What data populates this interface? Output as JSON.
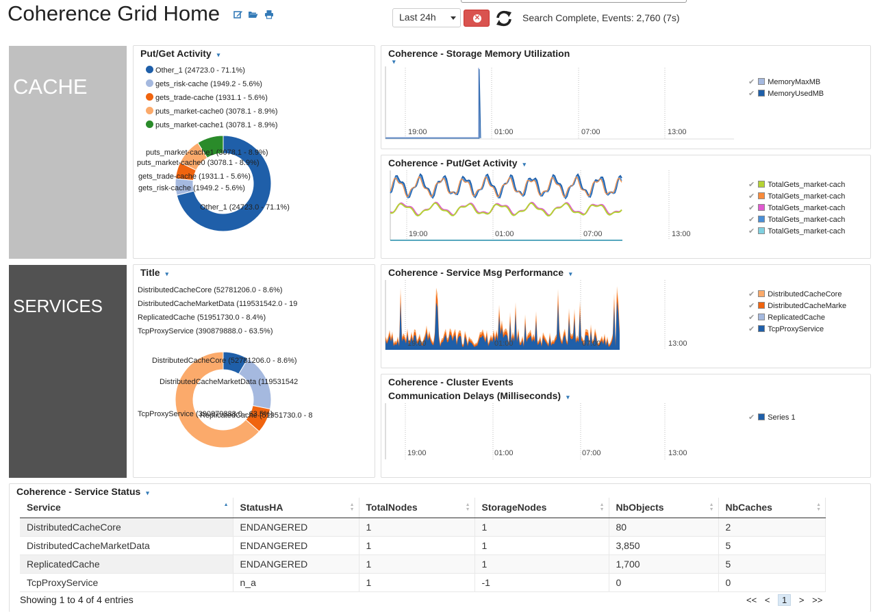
{
  "header": {
    "title": "Coherence Grid Home",
    "icons": [
      "edit-icon",
      "folder-open-icon",
      "print-icon"
    ],
    "time_range": "Last 24h",
    "status": "Search Complete, Events: 2,760 (7s)"
  },
  "sections": {
    "cache_label": "CACHE",
    "services_label": "SERVICES"
  },
  "colors": {
    "cache_tile": "#c0c0c0",
    "services_tile": "#525252",
    "accent_blue": "#1f5fa9",
    "orange": "#f59a4a"
  },
  "putget_pie": {
    "title": "Put/Get Activity",
    "legend": [
      {
        "label": "Other_1 (24723.0 - 71.1%)",
        "color": "#1f5fa9",
        "percent": 71.1
      },
      {
        "label": "gets_risk-cache (1949.2 - 5.6%)",
        "color": "#a5b9df",
        "percent": 5.6
      },
      {
        "label": "gets_trade-cache (1931.1 - 5.6%)",
        "color": "#f0640f",
        "percent": 5.6
      },
      {
        "label": "puts_market-cache0 (3078.1 - 8.9%)",
        "color": "#fbaa6b",
        "percent": 8.9
      },
      {
        "label": "puts_market-cache1 (3078.1 - 8.9%)",
        "color": "#2a8b2a",
        "percent": 8.9
      }
    ],
    "donut_labels": [
      "puts_market-cache1 (3078.1 - 8.9%)",
      "puts_market-cache0 (3078.1 - 8.9%)",
      "gets_trade-cache (1931.1 - 5.6%)",
      "gets_risk-cache (1949.2 - 5.6%)",
      "Other_1 (24723.0 - 71.1%)"
    ]
  },
  "services_pie": {
    "title": "Title",
    "legend": [
      "DistributedCacheCore (52781206.0 - 8.6%)",
      "DistributedCacheMarketData (119531542.0 - 19",
      "ReplicatedCache (51951730.0 - 8.4%)",
      "TcpProxyService (390879888.0 - 63.5%)"
    ],
    "donut_labels": [
      "DistributedCacheCore (52781206.0 - 8.6%)",
      "DistributedCacheMarketData (119531542",
      "ReplicatedCache (51951730.0 - 8",
      "TcpProxyService (390879888.0 - 63.5%)"
    ],
    "slices": [
      {
        "name": "DistributedCacheCore",
        "percent": 8.6,
        "color": "#1f5fa9"
      },
      {
        "name": "DistributedCacheMarketData",
        "percent": 19.5,
        "color": "#a5b9df"
      },
      {
        "name": "ReplicatedCache",
        "percent": 8.4,
        "color": "#f0640f"
      },
      {
        "name": "TcpProxyService",
        "percent": 63.5,
        "color": "#fbaa6b"
      }
    ]
  },
  "memory_chart": {
    "title": "Coherence - Storage Memory Utilization",
    "ticks": [
      "19:00",
      "01:00",
      "07:00",
      "13:00"
    ],
    "legend": [
      {
        "label": "MemoryMaxMB",
        "color": "#a5b9df"
      },
      {
        "label": "MemoryUsedMB",
        "color": "#1f5fa9"
      }
    ]
  },
  "putget_chart": {
    "title": "Coherence - Put/Get Activity",
    "ticks": [
      "19:00",
      "01:00",
      "07:00",
      "13:00"
    ],
    "legend": [
      {
        "label": "TotalGets_market-cach",
        "color": "#b5d334"
      },
      {
        "label": "TotalGets_market-cach",
        "color": "#f98b3b"
      },
      {
        "label": "TotalGets_market-cach",
        "color": "#e05ad0"
      },
      {
        "label": "TotalGets_market-cach",
        "color": "#4a8fd8"
      },
      {
        "label": "TotalGets_market-cach",
        "color": "#7fd0e0"
      }
    ]
  },
  "msg_chart": {
    "title": "Coherence - Service Msg Performance",
    "ticks": [
      "19:00",
      "01:00",
      "07:00",
      "13:00"
    ],
    "legend": [
      {
        "label": "DistributedCacheCore",
        "color": "#fbaa6b"
      },
      {
        "label": "DistributedCacheMarke",
        "color": "#f0640f"
      },
      {
        "label": "ReplicatedCache",
        "color": "#a5b9df"
      },
      {
        "label": "TcpProxyService",
        "color": "#1f5fa9"
      }
    ]
  },
  "events_chart": {
    "title_line1": "Coherence - Cluster Events",
    "title_line2": "Communication Delays (Milliseconds)",
    "ticks": [
      "19:00",
      "01:00",
      "07:00",
      "13:00"
    ],
    "legend": [
      {
        "label": "Series 1",
        "color": "#1f5fa9"
      }
    ]
  },
  "service_status": {
    "title": "Coherence - Service Status",
    "columns": [
      "Service",
      "StatusHA",
      "TotalNodes",
      "StorageNodes",
      "NbObjects",
      "NbCaches"
    ],
    "rows": [
      [
        "DistributedCacheCore",
        "ENDANGERED",
        "1",
        "1",
        "80",
        "2"
      ],
      [
        "DistributedCacheMarketData",
        "ENDANGERED",
        "1",
        "1",
        "3,850",
        "5"
      ],
      [
        "ReplicatedCache",
        "ENDANGERED",
        "1",
        "1",
        "1,700",
        "5"
      ],
      [
        "TcpProxyService",
        "n_a",
        "1",
        "-1",
        "0",
        "0"
      ]
    ],
    "info": "Showing 1 to 4 of 4 entries",
    "pager": {
      "first": "<<",
      "prev": "<",
      "current": "1",
      "next": ">",
      "last": ">>"
    }
  }
}
